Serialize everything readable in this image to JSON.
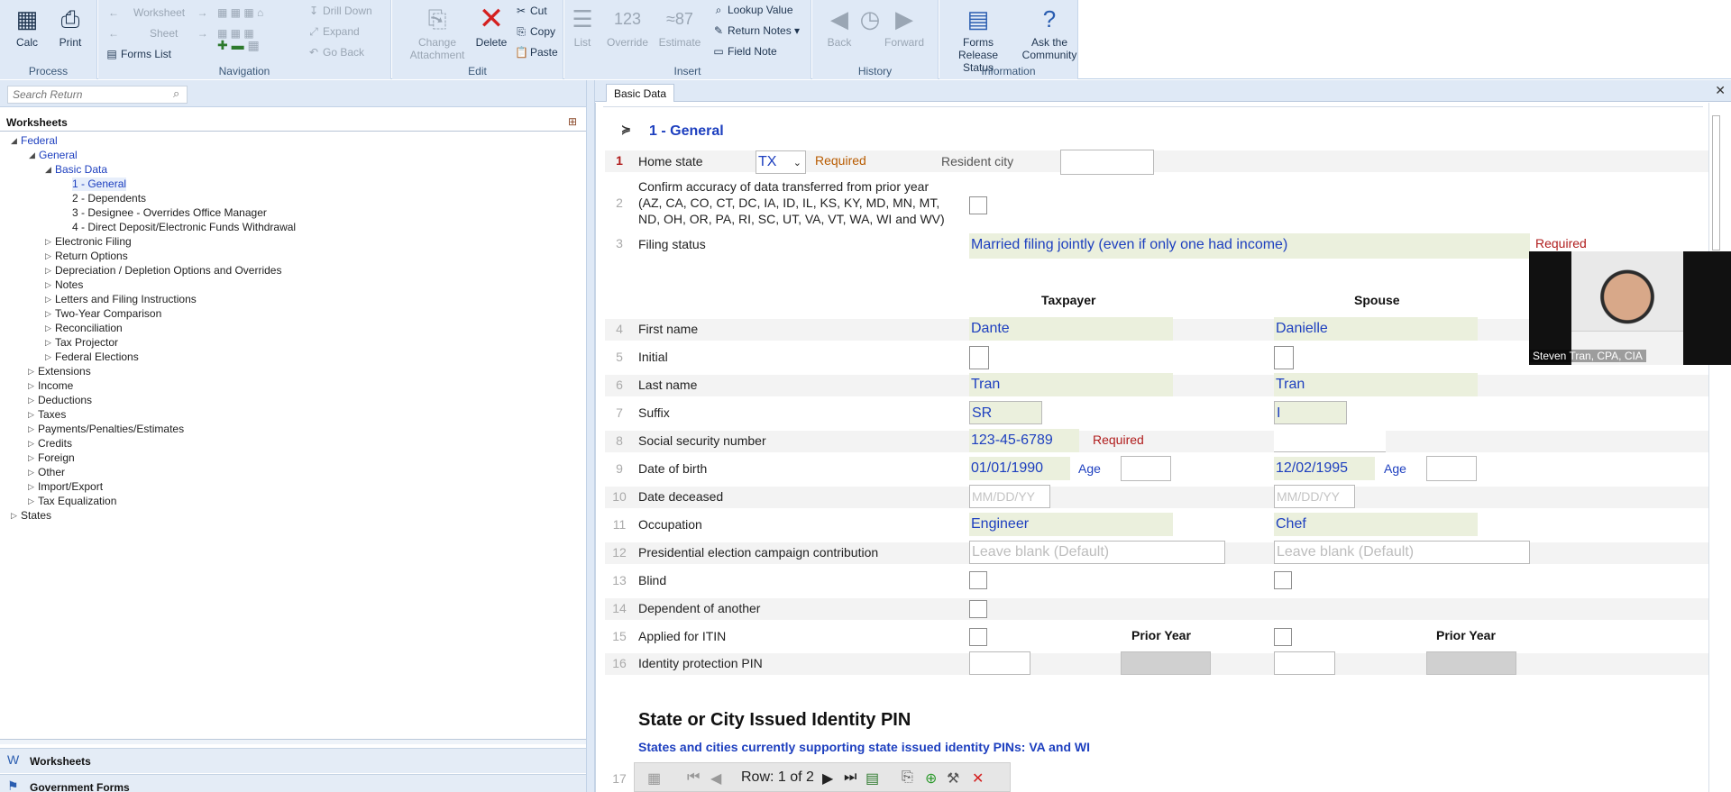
{
  "ribbon": {
    "process": {
      "caption": "Process",
      "calc": "Calc",
      "print": "Print"
    },
    "navigation": {
      "caption": "Navigation",
      "worksheet": "Worksheet",
      "sheet": "Sheet",
      "forms_list": "Forms List",
      "drill_down": "Drill Down",
      "expand": "Expand",
      "go_back": "Go Back"
    },
    "edit": {
      "caption": "Edit",
      "change_attachment": "Change Attachment",
      "delete": "Delete",
      "cut": "Cut",
      "copy": "Copy",
      "paste": "Paste"
    },
    "insert": {
      "caption": "Insert",
      "list": "List",
      "override": "Override",
      "estimate": "Estimate",
      "lookup_value": "Lookup Value",
      "return_notes": "Return Notes",
      "field_note": "Field Note"
    },
    "history": {
      "caption": "History",
      "back": "Back",
      "forward": "Forward"
    },
    "information": {
      "caption": "Information",
      "forms_release_status": "Forms Release Status",
      "ask_community": "Ask the Community"
    }
  },
  "search": {
    "placeholder": "Search Return"
  },
  "worksheets_panel": {
    "title": "Worksheets",
    "tree": {
      "federal": "Federal",
      "general": "General",
      "basic_data": "Basic Data",
      "basic_items": [
        "1 - General",
        "2 - Dependents",
        "3 - Designee - Overrides Office Manager",
        "4 - Direct Deposit/Electronic Funds Withdrawal"
      ],
      "general_items": [
        "Electronic Filing",
        "Return Options",
        "Depreciation / Depletion Options and Overrides",
        "Notes",
        "Letters and Filing Instructions",
        "Two-Year Comparison",
        "Reconciliation",
        "Tax Projector",
        "Federal Elections"
      ],
      "federal_items": [
        "Extensions",
        "Income",
        "Deductions",
        "Taxes",
        "Payments/Penalties/Estimates",
        "Credits",
        "Foreign",
        "Other",
        "Import/Export",
        "Tax Equalization"
      ],
      "states": "States"
    },
    "bottom_worksheets": "Worksheets",
    "bottom_government_forms": "Government Forms"
  },
  "tab": {
    "label": "Basic Data"
  },
  "form": {
    "section_title": "1 - General",
    "line1": {
      "num": "1",
      "label": "Home state",
      "value": "TX",
      "required": "Required",
      "city_label": "Resident city"
    },
    "line2": {
      "num": "2",
      "label_l1": "Confirm accuracy of data transferred from prior year",
      "label_l2": "(AZ, CA, CO, CT, DC, IA, ID, IL, KS, KY, MD, MN, MT,",
      "label_l3": "ND, OH, OR, PA, RI, SC, UT, VA, VT, WA, WI and WV)"
    },
    "line3": {
      "num": "3",
      "label": "Filing status",
      "value": "Married filing jointly (even if only one had income)",
      "required": "Required"
    },
    "col_taxpayer": "Taxpayer",
    "col_spouse": "Spouse",
    "line4": {
      "num": "4",
      "label": "First name",
      "tp": "Dante",
      "sp": "Danielle"
    },
    "line5": {
      "num": "5",
      "label": "Initial"
    },
    "line6": {
      "num": "6",
      "label": "Last name",
      "tp": "Tran",
      "sp": "Tran"
    },
    "line7": {
      "num": "7",
      "label": "Suffix",
      "tp": "SR",
      "sp": "I"
    },
    "line8": {
      "num": "8",
      "label": "Social security number",
      "tp": "123-45-6789",
      "required": "Required",
      "sp": ""
    },
    "line9": {
      "num": "9",
      "label": "Date of birth",
      "tp": "01/01/1990",
      "sp": "12/02/1995",
      "age": "Age"
    },
    "line10": {
      "num": "10",
      "label": "Date deceased",
      "placeholder": "MM/DD/YY"
    },
    "line11": {
      "num": "11",
      "label": "Occupation",
      "tp": "Engineer",
      "sp": "Chef"
    },
    "line12": {
      "num": "12",
      "label": "Presidential election campaign contribution",
      "placeholder": "Leave blank (Default)"
    },
    "line13": {
      "num": "13",
      "label": "Blind"
    },
    "line14": {
      "num": "14",
      "label": "Dependent of another"
    },
    "line15": {
      "num": "15",
      "label": "Applied for ITIN",
      "prior_year": "Prior Year"
    },
    "line16": {
      "num": "16",
      "label": "Identity protection PIN"
    },
    "state_pin": {
      "title": "State or City Issued Identity PIN",
      "subtitle": "States and cities currently supporting state issued identity PINs: VA and WI",
      "num": "17"
    },
    "navigator": {
      "row_text": "Row: 1 of 2"
    }
  },
  "video": {
    "name": "Steven Tran, CPA, CIA"
  }
}
